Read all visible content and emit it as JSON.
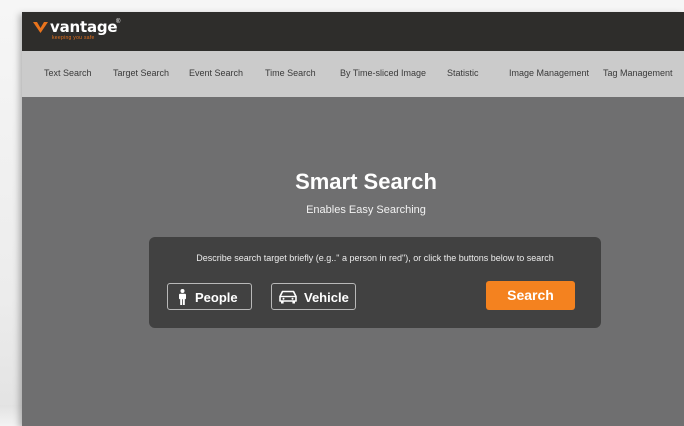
{
  "brand": {
    "name": "vantage",
    "registered": "®",
    "tagline": "keeping you safe"
  },
  "nav": {
    "items": [
      {
        "label": "Text Search"
      },
      {
        "label": "Target Search"
      },
      {
        "label": "Event Search"
      },
      {
        "label": "Time Search"
      },
      {
        "label": "By Time-sliced Image"
      },
      {
        "label": "Statistic"
      },
      {
        "label": "Image Management"
      },
      {
        "label": "Tag Management"
      }
    ]
  },
  "hero": {
    "title": "Smart Search",
    "subtitle": "Enables Easy Searching"
  },
  "search_panel": {
    "hint": "Describe search target briefly (e.g..\" a person in red\"), or click the buttons below to search",
    "people_label": "People",
    "vehicle_label": "Vehicle",
    "search_label": "Search"
  },
  "colors": {
    "topbar": "#2e2d2b",
    "navbar": "#cbcbcb",
    "main_bg": "#6f6f70",
    "panel_bg": "#414141",
    "accent": "#f4821f"
  }
}
